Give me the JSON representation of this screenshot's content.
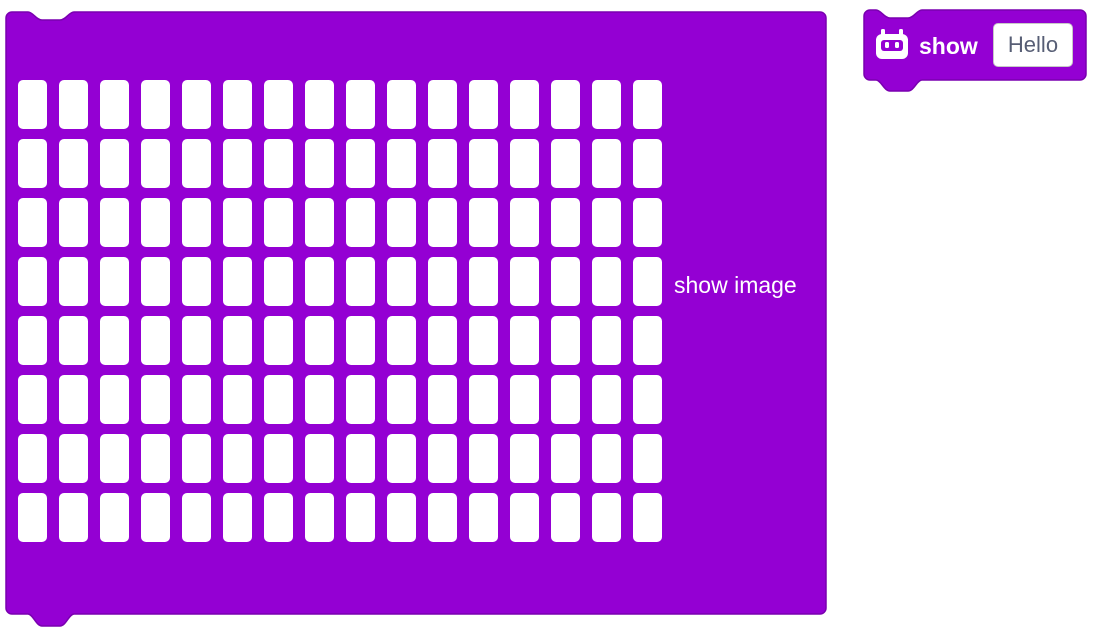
{
  "colors": {
    "block_fill": "#9400D3",
    "block_stroke": "#7a00b0",
    "led_off": "#ffffff",
    "field_text": "#575e75"
  },
  "show_image_block": {
    "label": "show image",
    "led_matrix": {
      "rows": 8,
      "columns": 16,
      "state": "all-off"
    }
  },
  "show_block": {
    "icon": "robot-icon",
    "label": "show",
    "text_value": "Hello"
  }
}
